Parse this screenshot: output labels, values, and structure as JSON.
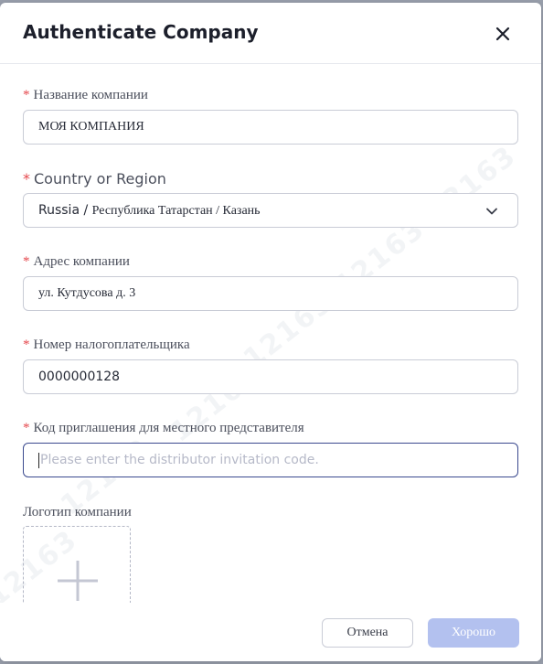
{
  "dialog": {
    "title": "Authenticate Company",
    "close_icon": "close-icon"
  },
  "watermark_text": "12163",
  "fields": {
    "company_name": {
      "required": "*",
      "label": "Название компании",
      "value": "МОЯ КОМПАНИЯ"
    },
    "country": {
      "required": "*",
      "label": "Country or Region",
      "value_part1": "Russia / ",
      "value_part2": "Республика Татарстан / Казань",
      "icon": "chevron-down-icon"
    },
    "address": {
      "required": "*",
      "label": "Адрес компании",
      "value": "ул. Кутдусова д. 3"
    },
    "tax_number": {
      "required": "*",
      "label": "Номер налогоплательщика",
      "value": "0000000128"
    },
    "invitation_code": {
      "required": "*",
      "label": "Код приглашения для местного представителя",
      "placeholder": "Please enter the distributor invitation code."
    },
    "logo": {
      "label": "Логотип компании",
      "icon": "plus-icon"
    }
  },
  "footer": {
    "cancel_label": "Отмена",
    "ok_label": "Хорошо"
  },
  "colors": {
    "required": "#e5484d",
    "focus_border": "#3b4a8f",
    "primary_disabled": "#b3c1ef"
  }
}
